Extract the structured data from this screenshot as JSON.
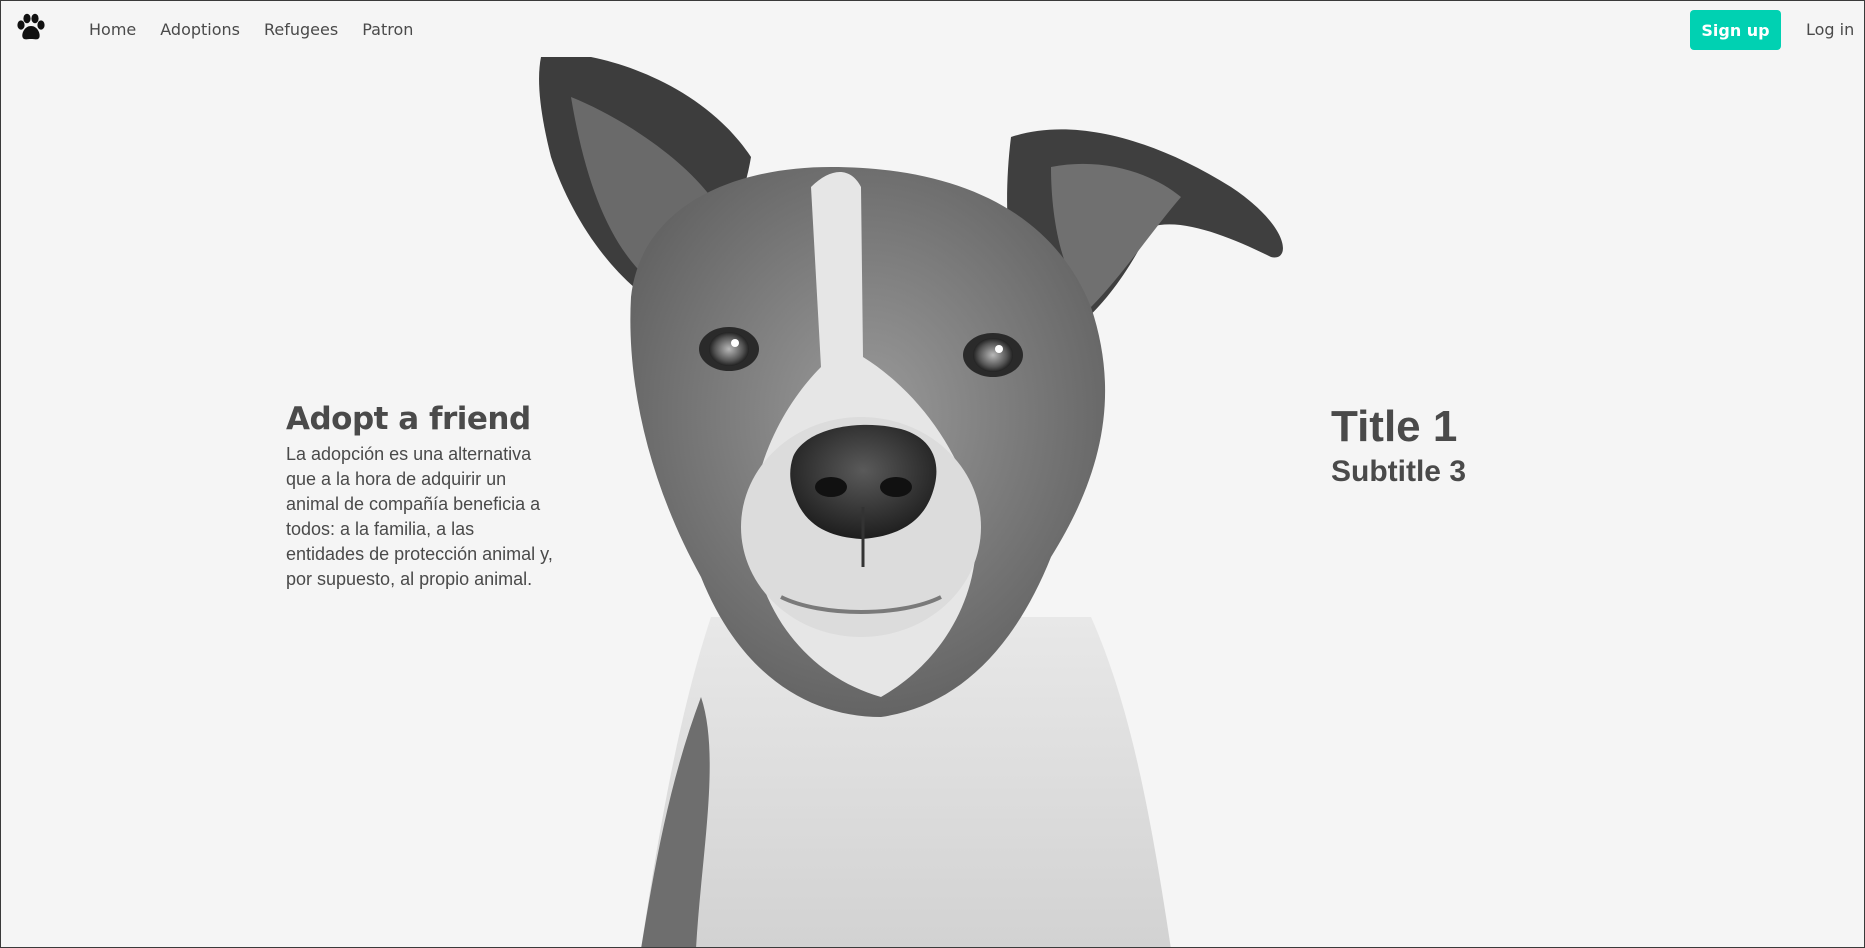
{
  "navbar": {
    "brand_icon": "paw-icon",
    "links": [
      "Home",
      "Adoptions",
      "Refugees",
      "Patron"
    ],
    "signup_label": "Sign up",
    "login_label": "Log in",
    "accent_color": "#00d1b2"
  },
  "hero": {
    "left": {
      "title": "Adopt a friend",
      "body": "La adopción es una alternativa que a la hora de adquirir un animal de compañía beneficia a todos: a la familia, a las entidades de protección animal y, por supuesto, al propio animal."
    },
    "right": {
      "title": "Title 1",
      "subtitle": "Subtitle 3"
    },
    "image": "dog-portrait"
  }
}
